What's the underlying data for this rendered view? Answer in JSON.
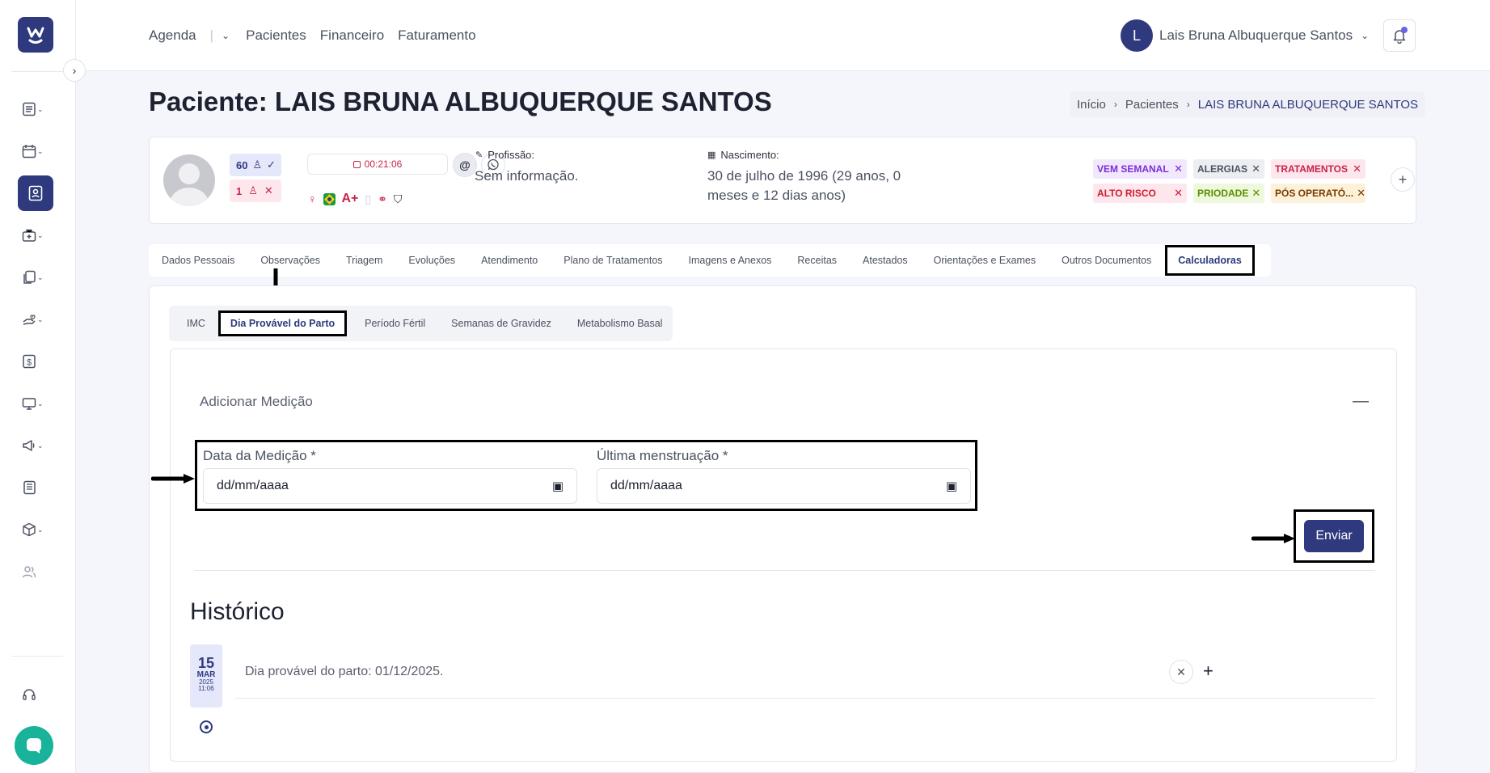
{
  "topbar": {
    "nav": [
      "Agenda",
      "Pacientes",
      "Financeiro",
      "Faturamento"
    ],
    "user_initial": "L",
    "user_name": "Lais Bruna Albuquerque Santos"
  },
  "page": {
    "title": "Paciente: LAIS BRUNA ALBUQUERQUE SANTOS",
    "breadcrumb": [
      "Início",
      "Pacientes",
      "LAIS BRUNA ALBUQUERQUE SANTOS"
    ]
  },
  "patient": {
    "count_present": "60",
    "count_absent": "1",
    "timer": "00:21:06",
    "blood_type": "A+",
    "profession_label": "Profissão:",
    "profession_value": "Sem informação.",
    "birth_label": "Nascimento:",
    "birth_value": "30 de julho de 1996 (29 anos, 0 meses e 12 dias anos)",
    "tags": [
      {
        "label": "VEM SEMANAL",
        "color": "#7b2fd6",
        "bg": "#f2e8fd"
      },
      {
        "label": "ALERGIAS",
        "color": "#4a5160",
        "bg": "#eceef2"
      },
      {
        "label": "TRATAMENTOS",
        "color": "#c8234a",
        "bg": "#fde7ec"
      },
      {
        "label": "ALTO RISCO",
        "color": "#d01b2e",
        "bg": "#fde7ec"
      },
      {
        "label": "PRIODADE",
        "color": "#5a8f00",
        "bg": "#eef8dc"
      },
      {
        "label": "PÓS OPERATÓ...",
        "color": "#7a3b00",
        "bg": "#fdf2d9"
      }
    ]
  },
  "tabs": [
    "Dados Pessoais",
    "Observações",
    "Triagem",
    "Evoluções",
    "Atendimento",
    "Plano de Tratamentos",
    "Imagens e Anexos",
    "Receitas",
    "Atestados",
    "Orientações e Exames",
    "Outros Documentos",
    "Calculadoras"
  ],
  "subtabs": [
    "IMC",
    "Dia Provável do Parto",
    "Período Fértil",
    "Semanas de Gravidez",
    "Metabolismo Basal"
  ],
  "form": {
    "section_title": "Adicionar Medição",
    "field1_label": "Data da Medição *",
    "field1_value": "dd/mm/aaaa",
    "field2_label": "Última menstruação *",
    "field2_value": "dd/mm/aaaa",
    "submit_label": "Enviar"
  },
  "history": {
    "title": "Histórico",
    "entries": [
      {
        "day": "15",
        "month": "MAR",
        "year": "2025",
        "time": "11:06",
        "text": "Dia provável do parto: 01/12/2025."
      }
    ]
  },
  "colors": {
    "primary": "#2e3a7d",
    "accent_red": "#c8234a",
    "chat": "#18b39a"
  }
}
